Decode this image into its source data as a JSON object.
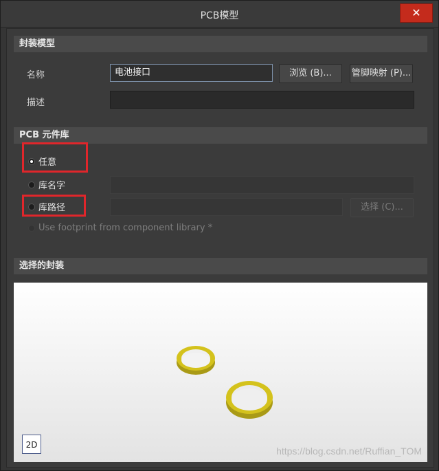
{
  "window": {
    "title": "PCB模型",
    "close_label": "✕"
  },
  "footprint": {
    "header": "封装模型",
    "name_label": "名称",
    "name_value": "电池接口",
    "browse_button": "浏览 (B)...",
    "pin_map_button": "管脚映射 (P)...",
    "description_label": "描述",
    "description_value": ""
  },
  "library": {
    "header": "PCB 元件库",
    "option_any": "任意",
    "option_lib_name": "库名字",
    "option_lib_path": "库路径",
    "select_button": "选择 (C)...",
    "use_component_library": "Use footprint from component library *",
    "selected_option": "任意"
  },
  "selected": {
    "header": "选择的封装",
    "view_mode": "2D"
  },
  "watermark": "https://blog.csdn.net/Ruffian_TOM",
  "colors": {
    "highlight": "#e0262b",
    "ring": "#d4c21c"
  }
}
